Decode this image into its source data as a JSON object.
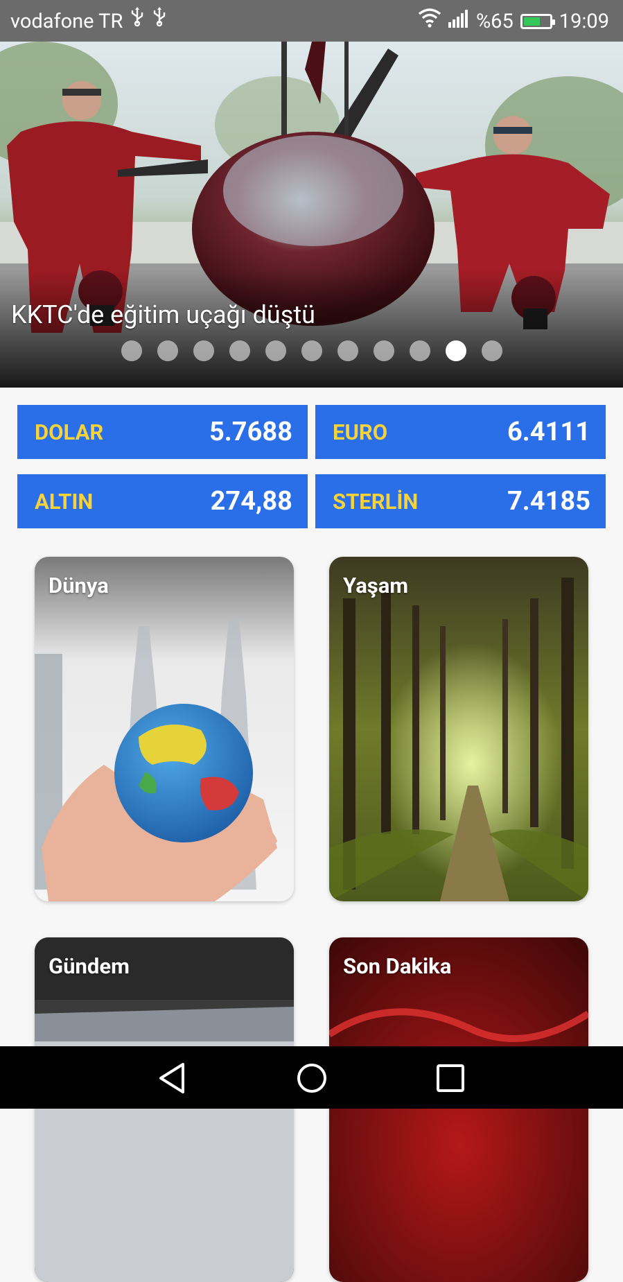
{
  "status_bar": {
    "carrier": "vodafone TR",
    "battery_percent": "%65",
    "time": "19:09",
    "battery_level": 0.65,
    "battery_color": "#34c759"
  },
  "hero": {
    "headline": "KKTC'de eğitim uçağı düştü",
    "slide_count": 11,
    "active_index": 9
  },
  "currencies": [
    {
      "name": "DOLAR",
      "value": "5.7688"
    },
    {
      "name": "EURO",
      "value": "6.4111"
    },
    {
      "name": "ALTIN",
      "value": "274,88"
    },
    {
      "name": "STERLİN",
      "value": "7.4185"
    }
  ],
  "categories": [
    {
      "label": "Dünya"
    },
    {
      "label": "Yaşam"
    },
    {
      "label": "Gündem"
    },
    {
      "label": "Son Dakika"
    }
  ],
  "colors": {
    "currency_bg": "#2a6ee8",
    "currency_name": "#f7d33a",
    "status_bar": "#6b6b6b"
  },
  "nav": {
    "icons": [
      "back-icon",
      "home-icon",
      "recents-icon"
    ]
  }
}
